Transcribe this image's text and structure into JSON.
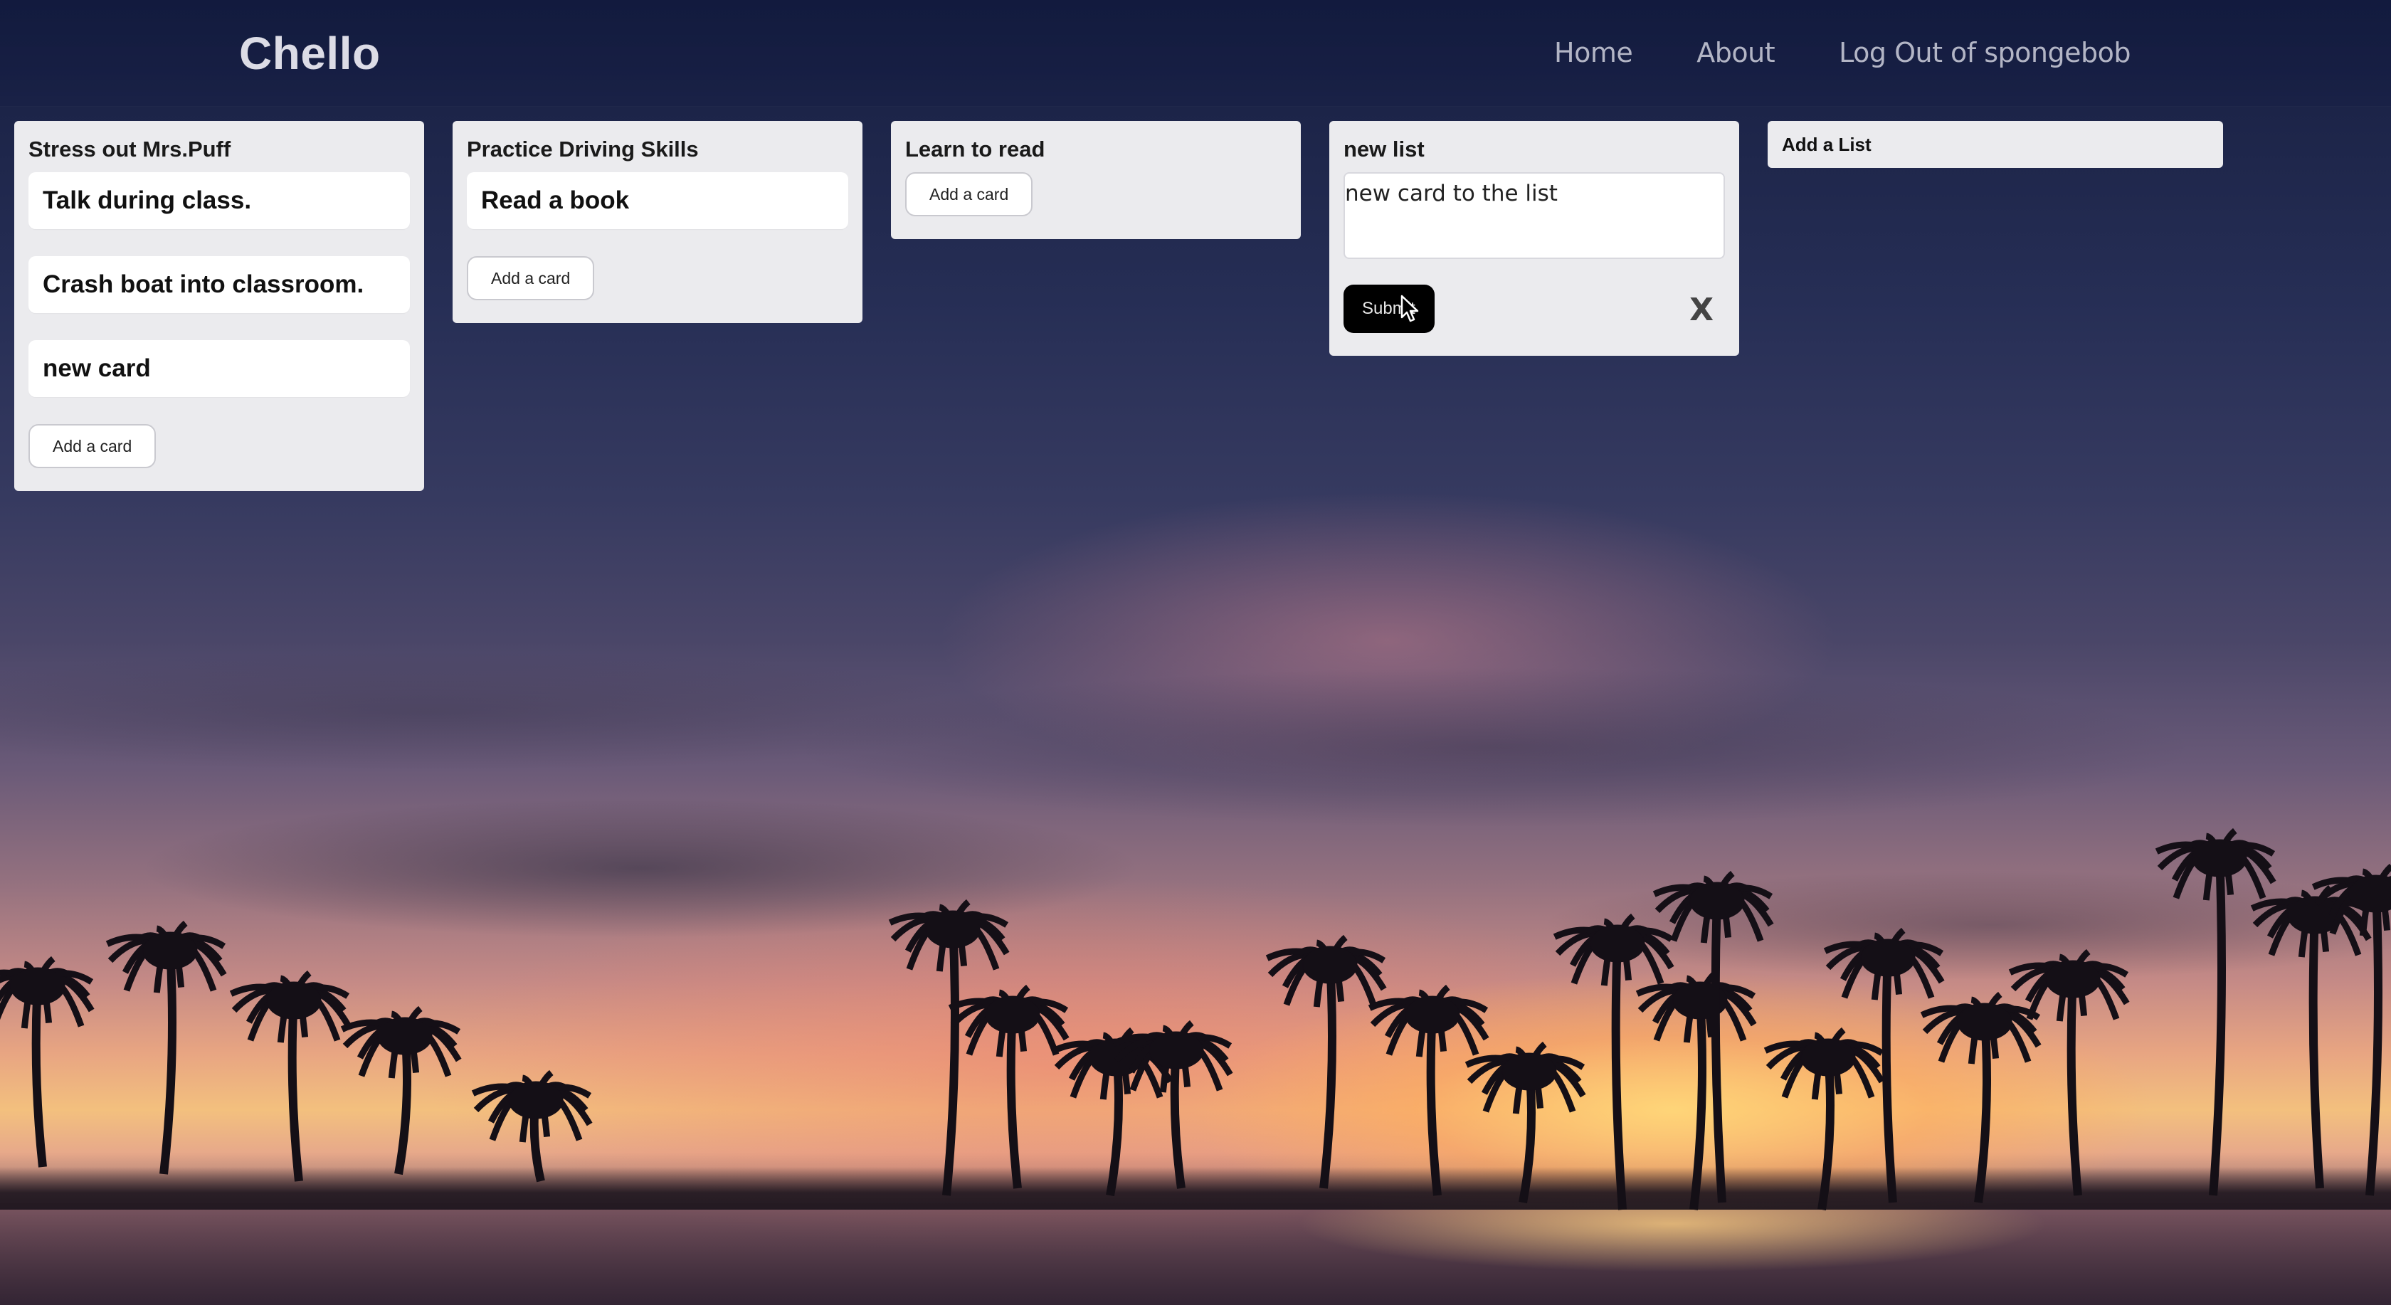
{
  "header": {
    "brand": "Chello",
    "nav": [
      {
        "label": "Home"
      },
      {
        "label": "About"
      },
      {
        "label": "Log Out of spongebob"
      }
    ]
  },
  "lists": [
    {
      "title": "Stress out Mrs.Puff",
      "cards": [
        "Talk during class.",
        "Crash boat into classroom.",
        "new card"
      ],
      "add_card_label": "Add a card"
    },
    {
      "title": "Practice Driving Skills",
      "cards": [
        "Read a book"
      ],
      "add_card_label": "Add a card"
    },
    {
      "title": "Learn to read",
      "cards": [],
      "add_card_label": "Add a card"
    },
    {
      "title": "new list",
      "cards": [],
      "new_card_value": "new card to the list",
      "submit_label": "Submit",
      "close_label": "X"
    }
  ],
  "add_list_label": "Add a List",
  "colors": {
    "header_bg": "#141b3c",
    "list_bg": "#ebebee",
    "card_bg": "#ffffff",
    "submit_bg": "#000000"
  }
}
